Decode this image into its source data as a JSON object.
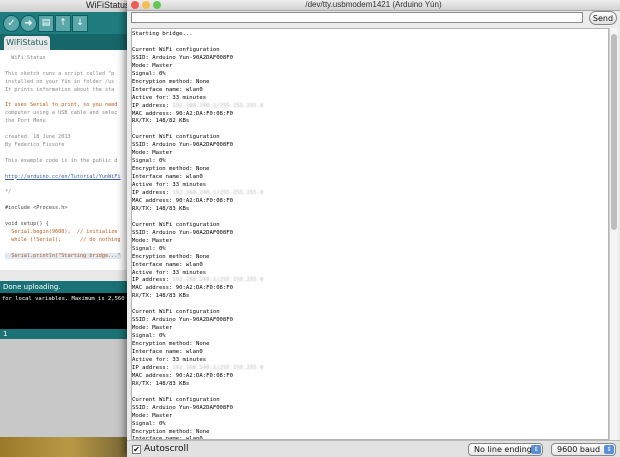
{
  "ide": {
    "title": "WiFiStatus |",
    "tab": "WiFiStatus",
    "toolbar_icons": [
      "verify-icon",
      "upload-icon",
      "new-icon",
      "open-icon",
      "save-icon"
    ],
    "code_lines": [
      "  WiFi Status",
      "",
      "This sketch runs a script called \"p",
      "installed on your Yún in folder /us",
      "It prints information about the sta",
      "",
      "It uses Serial to print, so you need",
      "computer using a USB cable and selec",
      "the Port Menu",
      "",
      "created  18 June 2013",
      "By Federico Fissore",
      "",
      "This example code is in the public d",
      "",
      "http://arduino.cc/en/Tutorial/YunWiFi",
      "",
      "*/",
      "",
      "#include <Process.h>",
      "",
      "void setup() {",
      "  Serial.begin(9600);  // initialize",
      "  while (!Serial);      // do nothing",
      "",
      "  Serial.println(\"Starting bridge...\""
    ],
    "status": "Done uploading.",
    "console": "for local variables. Maximum is 2,560",
    "footer": "1",
    "accent_color": "#1f7d7f"
  },
  "monitor": {
    "title": "/dev/tty.usbmodem1421 (Arduino Yún)",
    "input_value": "",
    "send_label": "Send",
    "output_lines": [
      "Starting bridge...",
      "",
      "Current WiFi configuration",
      "SSID: Arduino Yun-90A2DAF008F0",
      "Mode: Master",
      "Signal: 0%",
      "Encryption method: None",
      "Interface name: wlan0",
      "Active for: 33 minutes",
      "IP address: 192.168.240.1/255.255.255.0",
      "MAC address: 90:A2:DA:F0:08:F0",
      "RX/TX: 148/82 KBs",
      "",
      "Current WiFi configuration",
      "SSID: Arduino Yun-90A2DAF008F0",
      "Mode: Master",
      "Signal: 0%",
      "Encryption method: None",
      "Interface name: wlan0",
      "Active for: 33 minutes",
      "IP address: 192.168.240.1/255.255.255.0",
      "MAC address: 90:A2:DA:F0:08:F0",
      "RX/TX: 148/83 KBs",
      "",
      "Current WiFi configuration",
      "SSID: Arduino Yun-90A2DAF008F0",
      "Mode: Master",
      "Signal: 0%",
      "Encryption method: None",
      "Interface name: wlan0",
      "Active for: 33 minutes",
      "IP address: 192.168.240.1/255.255.255.0",
      "MAC address: 90:A2:DA:F0:08:F0",
      "RX/TX: 148/83 KBs",
      "",
      "Current WiFi configuration",
      "SSID: Arduino Yun-90A2DAF008F0",
      "Mode: Master",
      "Signal: 0%",
      "Encryption method: None",
      "Interface name: wlan0",
      "Active for: 33 minutes",
      "IP address: 192.168.240.1/255.255.255.0",
      "MAC address: 90:A2:DA:F0:08:F0",
      "RX/TX: 148/83 KBs",
      "",
      "Current WiFi configuration",
      "SSID: Arduino Yun-90A2DAF008F0",
      "Mode: Master",
      "Signal: 0%",
      "Encryption method: None",
      "Interface name: wlan0"
    ],
    "autoscroll_label": "Autoscroll",
    "autoscroll_checked": true,
    "line_ending": "No line ending",
    "baud": "9600 baud"
  }
}
